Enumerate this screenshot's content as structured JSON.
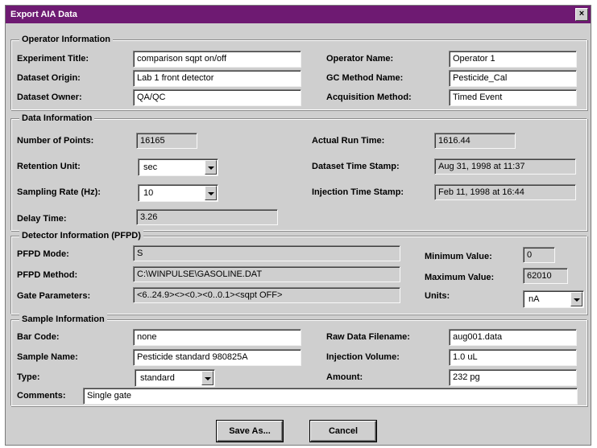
{
  "window": {
    "title": "Export AIA Data",
    "close_glyph": "×"
  },
  "operator": {
    "section_title": "Operator Information",
    "experiment_title_label": "Experiment Title:",
    "experiment_title_value": "comparison sqpt on/off",
    "dataset_origin_label": "Dataset Origin:",
    "dataset_origin_value": "Lab 1 front detector",
    "dataset_owner_label": "Dataset Owner:",
    "dataset_owner_value": "QA/QC",
    "operator_name_label": "Operator Name:",
    "operator_name_value": "Operator 1",
    "gc_method_label": "GC Method Name:",
    "gc_method_value": "Pesticide_Cal",
    "acquisition_method_label": "Acquisition Method:",
    "acquisition_method_value": "Timed Event"
  },
  "data_info": {
    "section_title": "Data Information",
    "num_points_label": "Number of Points:",
    "num_points_value": "16165",
    "retention_unit_label": "Retention Unit:",
    "retention_unit_value": "sec",
    "sampling_rate_label": "Sampling Rate (Hz):",
    "sampling_rate_value": "10",
    "delay_time_label": "Delay Time:",
    "delay_time_value": "3.26",
    "actual_run_time_label": "Actual Run Time:",
    "actual_run_time_value": "1616.44",
    "dataset_time_stamp_label": "Dataset Time Stamp:",
    "dataset_time_stamp_value": "Aug 31, 1998 at 11:37",
    "injection_time_stamp_label": "Injection Time Stamp:",
    "injection_time_stamp_value": "Feb 11, 1998 at 16:44"
  },
  "detector": {
    "section_title": "Detector Information  (PFPD)",
    "pfpd_mode_label": "PFPD Mode:",
    "pfpd_mode_value": "S",
    "pfpd_method_label": "PFPD Method:",
    "pfpd_method_value": "C:\\WINPULSE\\GASOLINE.DAT",
    "gate_params_label": "Gate Parameters:",
    "gate_params_value": "<6..24.9><><0.><0..0.1><sqpt OFF>",
    "min_value_label": "Minimum Value:",
    "min_value_value": "0",
    "max_value_label": "Maximum Value:",
    "max_value_value": "62010",
    "units_label": "Units:",
    "units_value": "nA"
  },
  "sample": {
    "section_title": "Sample Information",
    "bar_code_label": "Bar Code:",
    "bar_code_value": "none",
    "sample_name_label": "Sample Name:",
    "sample_name_value": "Pesticide standard 980825A",
    "type_label": "Type:",
    "type_value": "standard",
    "raw_filename_label": "Raw Data Filename:",
    "raw_filename_value": "aug001.data",
    "injection_volume_label": "Injection Volume:",
    "injection_volume_value": "1.0 uL",
    "amount_label": "Amount:",
    "amount_value": "232 pg",
    "comments_label": "Comments:",
    "comments_value": "Single gate"
  },
  "buttons": {
    "save_as": "Save As...",
    "cancel": "Cancel"
  }
}
